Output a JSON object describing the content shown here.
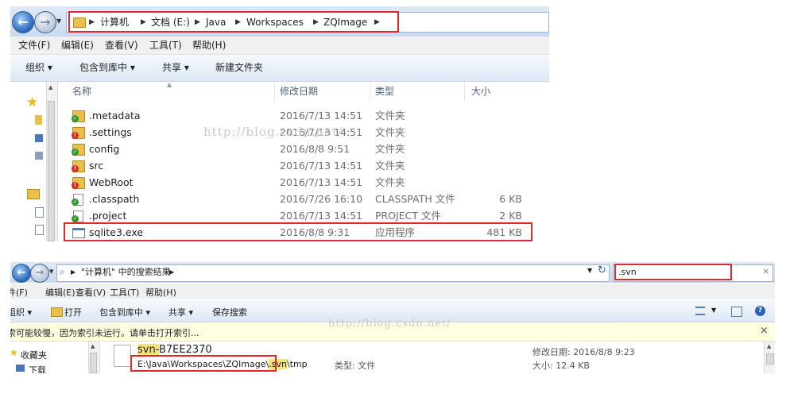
{
  "top_window": {
    "breadcrumb": [
      "计算机",
      "文档 (E:)",
      "Java",
      "Workspaces",
      "ZQImage"
    ],
    "menu": [
      "文件(F)",
      "编辑(E)",
      "查看(V)",
      "工具(T)",
      "帮助(H)"
    ],
    "toolbar": [
      "组织 ▾",
      "包含到库中 ▾",
      "共享 ▾",
      "新建文件夹"
    ],
    "columns": [
      "名称",
      "修改日期",
      "类型",
      "大小"
    ],
    "files": [
      {
        "name": ".metadata",
        "date": "2016/7/13 14:51",
        "type": "文件夹",
        "size": "",
        "icon": "folder-svn-ok-icon"
      },
      {
        "name": ".settings",
        "date": "2016/7/13 14:51",
        "type": "文件夹",
        "size": "",
        "icon": "folder-svn-modified-icon"
      },
      {
        "name": "config",
        "date": "2016/8/8 9:51",
        "type": "文件夹",
        "size": "",
        "icon": "folder-svn-ok-icon"
      },
      {
        "name": "src",
        "date": "2016/7/13 14:51",
        "type": "文件夹",
        "size": "",
        "icon": "folder-svn-modified-icon"
      },
      {
        "name": "WebRoot",
        "date": "2016/7/13 14:51",
        "type": "文件夹",
        "size": "",
        "icon": "folder-svn-modified-icon"
      },
      {
        "name": ".classpath",
        "date": "2016/7/26 16:10",
        "type": "CLASSPATH 文件",
        "size": "6 KB",
        "icon": "file-svn-ok-icon"
      },
      {
        "name": ".project",
        "date": "2016/7/13 14:51",
        "type": "PROJECT 文件",
        "size": "2 KB",
        "icon": "file-svn-ok-icon"
      },
      {
        "name": "sqlite3.exe",
        "date": "2016/8/8 9:31",
        "type": "应用程序",
        "size": "481 KB",
        "icon": "exe-icon"
      }
    ],
    "watermark": "http://blog.csdn.net/"
  },
  "bottom_window": {
    "breadcrumb": "\"计算机\" 中的搜索结果",
    "search_value": ".svn",
    "menu": [
      "件(F)",
      "查看(V)",
      "工具(T)",
      "帮助(H)"
    ],
    "menu_cut": "编辑(E)",
    "toolbar": [
      "组织 ▾",
      "打开",
      "包含到库中 ▾",
      "共享 ▾",
      "保存搜索"
    ],
    "infobar_text": "索可能较慢，因为索引未运行。请单击打开索引...",
    "sidebar": [
      "收藏夹",
      "下载"
    ],
    "result": {
      "name_prefix": "svn-",
      "name_suffix": "B7EE2370",
      "path_before": "E:\\Java\\Workspaces\\ZQImage\\",
      "path_highlight": ".svn",
      "path_after": "\\tmp",
      "type_label": "类型: 文件",
      "modified_label": "修改日期: 2016/8/8 9:23",
      "size_label": "大小: 12.4 KB"
    },
    "watermark": "http://blog.csdn.net/"
  },
  "colors": {
    "highlight_box": "#e0282e",
    "match_highlight": "#f3e47a",
    "folder": "#e9c04b"
  }
}
